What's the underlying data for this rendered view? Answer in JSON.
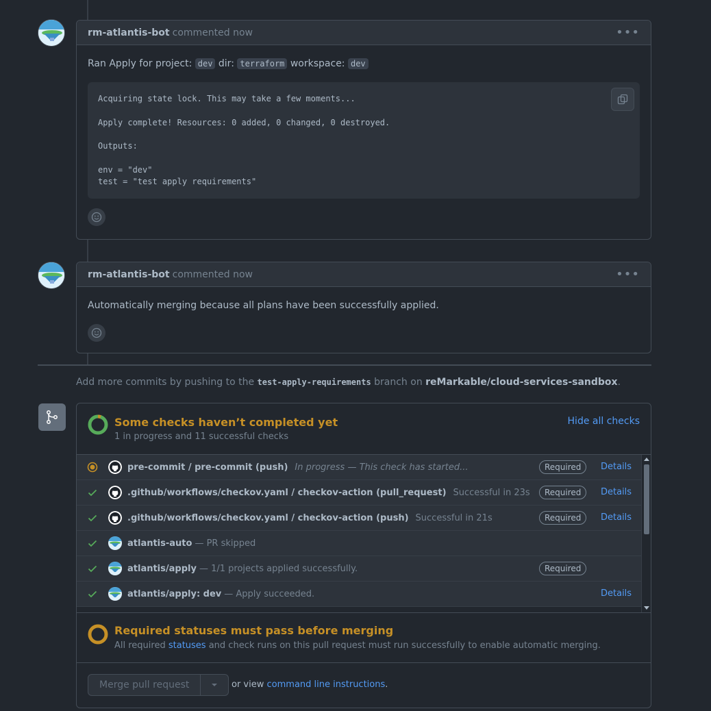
{
  "comments": [
    {
      "author": "rm-atlantis-bot",
      "meta": "commented now",
      "intro": {
        "ran": "Ran Apply for project:",
        "project": "dev",
        "dir_label": "dir:",
        "dir": "terraform",
        "workspace_label": "workspace:",
        "workspace": "dev"
      },
      "code": {
        "line1": "Acquiring state lock. This may take a few moments...",
        "line2": "Apply complete! Resources: 0 added, 0 changed, 0 destroyed.",
        "line3": "Outputs:",
        "line4": "env = \"dev\"",
        "line5": "test = \"test apply requirements\""
      }
    },
    {
      "author": "rm-atlantis-bot",
      "meta": "commented now",
      "body": "Automatically merging because all plans have been successfully applied."
    }
  ],
  "push_note": {
    "prefix": "Add more commits by pushing to the",
    "branch": "test-apply-requirements",
    "middle": "branch on",
    "repo": "reMarkable/cloud-services-sandbox",
    "suffix": "."
  },
  "checks": {
    "title": "Some checks haven’t completed yet",
    "subtitle": "1 in progress and 11 successful checks",
    "hide_link": "Hide all checks",
    "required_label": "Required",
    "details_label": "Details",
    "rows": [
      {
        "status": "in_progress",
        "avatar": "github",
        "name": "pre-commit / pre-commit (push)",
        "desc": "In progress — This check has started...",
        "required": true,
        "details": true
      },
      {
        "status": "success",
        "avatar": "github",
        "name": ".github/workflows/checkov.yaml / checkov-action (pull_request)",
        "desc": "Successful in 23s",
        "required": true,
        "details": true
      },
      {
        "status": "success",
        "avatar": "github",
        "name": ".github/workflows/checkov.yaml / checkov-action (push)",
        "desc": "Successful in 21s",
        "required": true,
        "details": true
      },
      {
        "status": "success",
        "avatar": "atlantis",
        "name": "atlantis-auto",
        "desc": "— PR skipped",
        "required": false,
        "details": false
      },
      {
        "status": "success",
        "avatar": "atlantis",
        "name": "atlantis/apply",
        "desc": "— 1/1 projects applied successfully.",
        "required": true,
        "details": false
      },
      {
        "status": "success",
        "avatar": "atlantis",
        "name": "atlantis/apply: dev",
        "desc": "— Apply succeeded.",
        "required": false,
        "details": true
      }
    ]
  },
  "requirements": {
    "title": "Required statuses must pass before merging",
    "prefix": "All required",
    "link": "statuses",
    "suffix": "and check runs on this pull request must run successfully to enable automatic merging."
  },
  "merge": {
    "button": "Merge pull request",
    "or_view": "or view",
    "cli_link": "command line instructions",
    "period": "."
  },
  "colors": {
    "pending": "#c69026",
    "success": "#57ab5a",
    "link": "#539bf5"
  }
}
